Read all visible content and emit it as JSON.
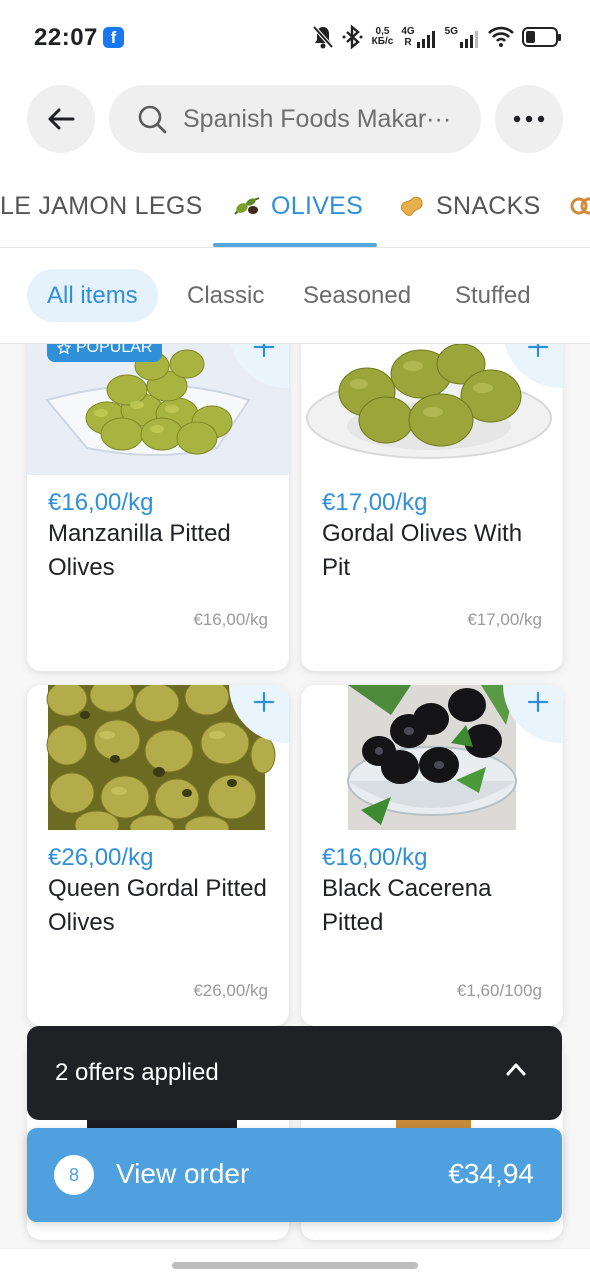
{
  "status_bar": {
    "time": "22:07",
    "app_badge": "f",
    "net_speed": "0,5",
    "net_unit": "КБ/с",
    "net1_label": "4G",
    "net1_sub": "R",
    "net2_label": "5G",
    "icons": [
      "mute-bell-icon",
      "bluetooth-icon",
      "signal-icon",
      "wifi-icon",
      "battery-icon"
    ]
  },
  "header": {
    "search_text": "Spanish Foods Makar···",
    "icons": [
      "back-arrow-icon",
      "search-icon",
      "more-icon"
    ]
  },
  "category_tabs": [
    {
      "label": "LE JAMON LEGS",
      "icon": "",
      "active": false
    },
    {
      "label": "OLIVES",
      "icon": "olive-icon",
      "active": true
    },
    {
      "label": "SNACKS",
      "icon": "peanut-icon",
      "active": false
    }
  ],
  "sub_tabs": [
    {
      "label": "All items",
      "active": true
    },
    {
      "label": "Classic",
      "active": false
    },
    {
      "label": "Seasoned",
      "active": false
    },
    {
      "label": "Stuffed",
      "active": false
    }
  ],
  "products": [
    {
      "price": "€16,00/kg",
      "name": "Manzanilla Pitted Olives",
      "unit_price": "€16,00/kg",
      "badge": "POPULAR"
    },
    {
      "price": "€17,00/kg",
      "name": "Gordal Olives With Pit",
      "unit_price": "€17,00/kg"
    },
    {
      "price": "€26,00/kg",
      "name": "Queen Gordal Pitted Olives",
      "unit_price": "€26,00/kg"
    },
    {
      "price": "€16,00/kg",
      "name": "Black Cacerena Pitted",
      "unit_price": "€1,60/100g"
    }
  ],
  "offers_bar": {
    "label": "2 offers applied"
  },
  "view_order": {
    "count": "8",
    "label": "View order",
    "total": "€34,94"
  },
  "colors": {
    "accent": "#2f8fd8",
    "button": "#4ea1de",
    "dark_bar": "#202125"
  }
}
